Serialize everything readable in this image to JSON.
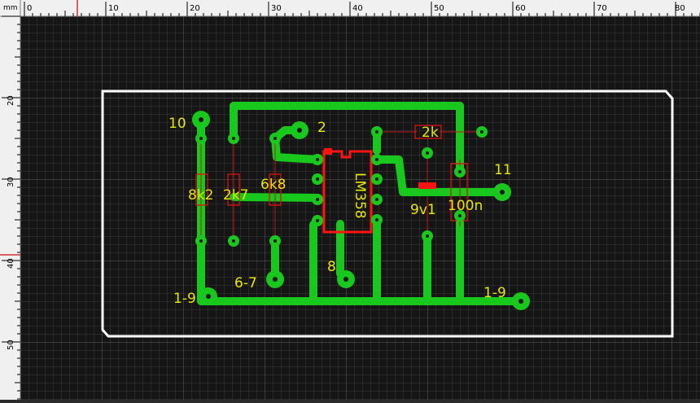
{
  "ruler": {
    "unit": "mm",
    "top_ticks": [
      "0",
      "10",
      "20",
      "30",
      "40",
      "50",
      "60",
      "70",
      "80"
    ],
    "left_ticks": [
      "20",
      "30",
      "40",
      "50"
    ]
  },
  "colors": {
    "background": "#151515",
    "grid_minor": "#3a3a3a",
    "grid_major": "#5a5a5a",
    "ruler_bg": "#f0f0f0",
    "track": "#19c81c",
    "board_outline": "#ffffff",
    "component_outline": "#e01010",
    "silkscreen_text": "#e6e600",
    "cursor_line": "#d03030"
  },
  "pcb": {
    "labels": {
      "pin10": "10",
      "pin2": "2",
      "pin11": "11",
      "pin8": "8",
      "pin6_7": "6-7",
      "pin1_9_left": "1-9",
      "pin1_9_right": "1-9",
      "r1": "8k2",
      "r2": "2k7",
      "r3": "6k8",
      "r4": "2k",
      "zener": "9v1",
      "cap": "100n",
      "ic": "LM358"
    }
  }
}
